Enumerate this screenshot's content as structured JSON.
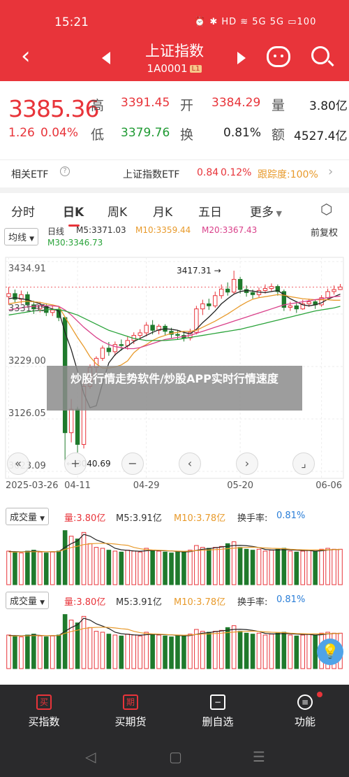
{
  "status": {
    "time": "15:21",
    "icons": "⏰ ✱ HD ≋ 5G 5G ▭100"
  },
  "header": {
    "title": "上证指数",
    "code": "1A0001",
    "level": "L1"
  },
  "quote": {
    "price": "3385.36",
    "change": "1.26",
    "change_pct": "0.04%",
    "high_label": "高",
    "high": "3391.45",
    "open_label": "开",
    "open": "3384.29",
    "vol_label": "量",
    "vol": "3.80亿",
    "low_label": "低",
    "low": "3379.76",
    "turn_label": "换",
    "turn": "0.81%",
    "amt_label": "额",
    "amt": "4527.4亿"
  },
  "etf": {
    "label": "相关ETF",
    "name": "上证指数ETF",
    "price": "0.84",
    "pct": "0.12%",
    "track": "跟踪度:100%"
  },
  "tabs": [
    "分时",
    "日K",
    "周K",
    "月K",
    "五日",
    "更多"
  ],
  "kline_header": {
    "ma_type": "均线",
    "period": "日线",
    "m5": "M5:3371.03",
    "m10": "M10:3359.44",
    "m20": "M20:3367.43",
    "m30": "M30:3346.73",
    "adjust": "前复权"
  },
  "overlay_text": "炒股行情走势软件/炒股APP实时行情速度",
  "volume": {
    "label": "成交量",
    "amount": "量:3.80亿",
    "m5": "M5:3.91亿",
    "m10": "M10:3.78亿",
    "turn_label": "换手率:",
    "turn": "0.81%"
  },
  "nav": [
    {
      "label": "买指数",
      "icon": "买"
    },
    {
      "label": "买期货",
      "icon": "期"
    },
    {
      "label": "删自选",
      "icon": "−"
    },
    {
      "label": "功能",
      "icon": "≡"
    }
  ],
  "chart_data": {
    "type": "candlestick",
    "y_ticks": [
      "3434.91",
      "3331.95",
      "3229.00",
      "3126.05",
      "3023.09"
    ],
    "x_ticks": [
      "2025-03-26",
      "04-11",
      "04-29",
      "05-20",
      "06-06"
    ],
    "max_annotation": "3417.31",
    "min_annotation": "3040.69",
    "ylim": [
      3023.09,
      3434.91
    ],
    "candles": [
      [
        3366,
        3372,
        3385,
        3350
      ],
      [
        3372,
        3361,
        3380,
        3355
      ],
      [
        3361,
        3370,
        3378,
        3352
      ],
      [
        3370,
        3350,
        3376,
        3344
      ],
      [
        3350,
        3342,
        3358,
        3332
      ],
      [
        3342,
        3348,
        3356,
        3335
      ],
      [
        3348,
        3335,
        3353,
        3328
      ],
      [
        3335,
        3340,
        3348,
        3328
      ],
      [
        3340,
        3325,
        3346,
        3318
      ],
      [
        3325,
        3099,
        3325,
        3041
      ],
      [
        3099,
        3145,
        3165,
        3080
      ],
      [
        3145,
        3076,
        3150,
        3060
      ],
      [
        3076,
        3190,
        3198,
        3068
      ],
      [
        3190,
        3227,
        3233,
        3185
      ],
      [
        3227,
        3245,
        3249,
        3215
      ],
      [
        3245,
        3265,
        3270,
        3240
      ],
      [
        3265,
        3258,
        3277,
        3250
      ],
      [
        3258,
        3272,
        3278,
        3250
      ],
      [
        3272,
        3270,
        3282,
        3260
      ],
      [
        3270,
        3280,
        3288,
        3262
      ],
      [
        3280,
        3290,
        3296,
        3273
      ],
      [
        3290,
        3295,
        3302,
        3283
      ],
      [
        3295,
        3310,
        3316,
        3288
      ],
      [
        3310,
        3300,
        3320,
        3292
      ],
      [
        3300,
        3308,
        3312,
        3292
      ],
      [
        3308,
        3298,
        3312,
        3290
      ],
      [
        3298,
        3292,
        3305,
        3285
      ],
      [
        3292,
        3290,
        3300,
        3282
      ],
      [
        3290,
        3285,
        3297,
        3278
      ],
      [
        3285,
        3296,
        3303,
        3280
      ],
      [
        3296,
        3342,
        3348,
        3292
      ],
      [
        3342,
        3352,
        3360,
        3330
      ],
      [
        3352,
        3348,
        3362,
        3340
      ],
      [
        3348,
        3368,
        3376,
        3344
      ],
      [
        3368,
        3381,
        3390,
        3362
      ],
      [
        3381,
        3375,
        3394,
        3368
      ],
      [
        3375,
        3400,
        3417,
        3370
      ],
      [
        3400,
        3380,
        3405,
        3372
      ],
      [
        3380,
        3374,
        3388,
        3366
      ],
      [
        3374,
        3370,
        3380,
        3362
      ],
      [
        3370,
        3378,
        3384,
        3365
      ],
      [
        3378,
        3382,
        3390,
        3372
      ],
      [
        3382,
        3386,
        3392,
        3376
      ],
      [
        3386,
        3376,
        3390,
        3368
      ],
      [
        3376,
        3345,
        3380,
        3338
      ],
      [
        3345,
        3348,
        3356,
        3338
      ],
      [
        3348,
        3342,
        3354,
        3334
      ],
      [
        3342,
        3352,
        3360,
        3340
      ],
      [
        3352,
        3356,
        3362,
        3346
      ],
      [
        3356,
        3350,
        3360,
        3342
      ],
      [
        3350,
        3364,
        3369,
        3346
      ],
      [
        3364,
        3376,
        3382,
        3360
      ],
      [
        3376,
        3380,
        3388,
        3370
      ],
      [
        3380,
        3385,
        3391,
        3379
      ]
    ],
    "ma": {
      "M5": [
        3362,
        3364,
        3362,
        3360,
        3356,
        3352,
        3346,
        3342,
        3338,
        3296,
        3262,
        3220,
        3176,
        3148,
        3152,
        3196,
        3236,
        3252,
        3262,
        3269,
        3278,
        3284,
        3290,
        3296,
        3301,
        3303,
        3302,
        3300,
        3296,
        3293,
        3302,
        3315,
        3326,
        3338,
        3352,
        3362,
        3371,
        3376,
        3378,
        3377,
        3375,
        3374,
        3376,
        3378,
        3370,
        3362,
        3356,
        3350,
        3348,
        3350,
        3354,
        3361,
        3366,
        3371
      ],
      "M10": [
        3352,
        3354,
        3356,
        3357,
        3356,
        3355,
        3352,
        3350,
        3347,
        3326,
        3306,
        3286,
        3268,
        3248,
        3234,
        3226,
        3226,
        3228,
        3232,
        3240,
        3256,
        3266,
        3272,
        3280,
        3286,
        3290,
        3294,
        3296,
        3298,
        3298,
        3300,
        3306,
        3312,
        3318,
        3325,
        3332,
        3340,
        3348,
        3355,
        3361,
        3364,
        3366,
        3368,
        3370,
        3369,
        3366,
        3364,
        3362,
        3361,
        3360,
        3360,
        3360,
        3359,
        3359
      ],
      "M20": [
        3340,
        3342,
        3344,
        3346,
        3347,
        3348,
        3348,
        3348,
        3347,
        3340,
        3330,
        3318,
        3306,
        3296,
        3286,
        3278,
        3272,
        3268,
        3266,
        3264,
        3264,
        3266,
        3270,
        3274,
        3278,
        3282,
        3284,
        3286,
        3288,
        3290,
        3294,
        3298,
        3302,
        3306,
        3310,
        3314,
        3318,
        3322,
        3326,
        3330,
        3334,
        3338,
        3342,
        3346,
        3350,
        3352,
        3354,
        3356,
        3358,
        3360,
        3362,
        3364,
        3366,
        3367
      ],
      "M30": [
        3330,
        3332,
        3334,
        3336,
        3338,
        3339,
        3340,
        3341,
        3341,
        3338,
        3334,
        3330,
        3324,
        3318,
        3312,
        3306,
        3300,
        3296,
        3292,
        3288,
        3284,
        3282,
        3280,
        3280,
        3280,
        3280,
        3281,
        3282,
        3284,
        3286,
        3288,
        3290,
        3292,
        3294,
        3296,
        3298,
        3300,
        3302,
        3305,
        3308,
        3311,
        3314,
        3317,
        3320,
        3323,
        3326,
        3329,
        3332,
        3335,
        3338,
        3340,
        3342,
        3344,
        3347
      ]
    },
    "volume_values": [
      3.6,
      3.5,
      3.4,
      3.6,
      3.7,
      3.5,
      3.4,
      3.5,
      3.6,
      5.8,
      5.2,
      4.9,
      5.6,
      4.4,
      4.0,
      3.9,
      3.7,
      3.6,
      3.5,
      3.7,
      3.6,
      3.5,
      3.9,
      3.7,
      3.6,
      3.5,
      3.4,
      3.6,
      3.5,
      3.7,
      4.2,
      4.0,
      3.9,
      4.0,
      4.1,
      4.4,
      4.6,
      4.0,
      3.8,
      3.7,
      3.8,
      3.6,
      3.7,
      3.8,
      3.9,
      3.6,
      3.5,
      3.6,
      3.7,
      3.6,
      3.8,
      3.9,
      3.8,
      3.8
    ],
    "volume_ma5": [
      3.55,
      3.55,
      3.52,
      3.55,
      3.6,
      3.56,
      3.52,
      3.54,
      3.54,
      4.0,
      4.4,
      4.7,
      5.4,
      5.2,
      4.8,
      4.56,
      4.3,
      3.9,
      3.74,
      3.68,
      3.62,
      3.58,
      3.64,
      3.68,
      3.66,
      3.64,
      3.62,
      3.56,
      3.52,
      3.54,
      3.68,
      3.8,
      3.86,
      3.96,
      4.04,
      4.12,
      4.2,
      4.22,
      4.18,
      4.1,
      3.98,
      3.78,
      3.72,
      3.72,
      3.76,
      3.74,
      3.7,
      3.66,
      3.66,
      3.6,
      3.64,
      3.72,
      3.76,
      3.78
    ],
    "volume_ma10": [
      3.5,
      3.5,
      3.5,
      3.52,
      3.54,
      3.55,
      3.54,
      3.54,
      3.55,
      3.78,
      3.98,
      4.12,
      4.3,
      4.38,
      4.42,
      4.44,
      4.42,
      4.36,
      4.28,
      4.22,
      4.0,
      3.86,
      3.76,
      3.72,
      3.7,
      3.66,
      3.62,
      3.6,
      3.58,
      3.6,
      3.66,
      3.7,
      3.72,
      3.76,
      3.8,
      3.86,
      3.92,
      3.96,
      4.0,
      4.02,
      3.98,
      3.94,
      3.9,
      3.88,
      3.86,
      3.8,
      3.76,
      3.74,
      3.72,
      3.72,
      3.72,
      3.74,
      3.76,
      3.78
    ],
    "volume_ylim": [
      0,
      6.0
    ]
  }
}
